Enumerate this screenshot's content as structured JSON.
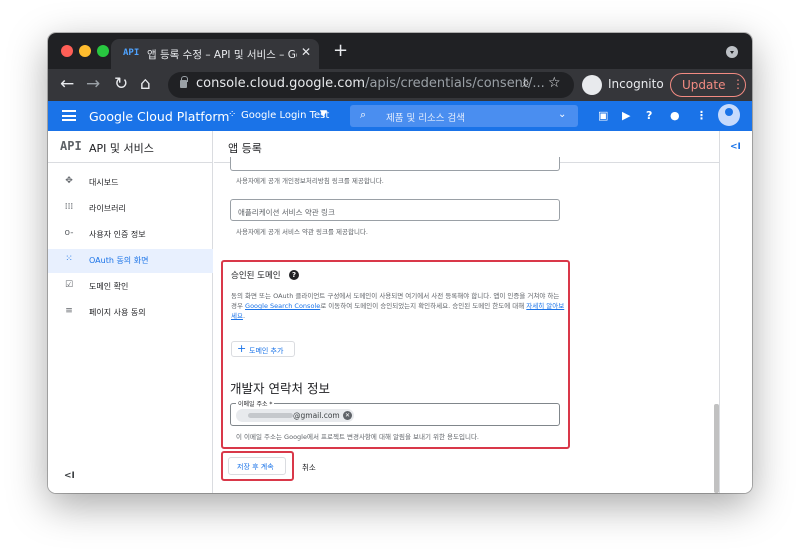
{
  "browser": {
    "tab": {
      "favicon_text": "API",
      "title": "앱 등록 수정 – API 및 서비스 – Goo",
      "close": "✕"
    },
    "new_tab": "+",
    "url_host": "console.cloud.google.com",
    "url_path": "/apis/credentials/consent/...",
    "incognito_label": "Incognito",
    "update_label": "Update",
    "update_menu": "⋮"
  },
  "gcp": {
    "brand": "Google Cloud Platform",
    "project": "Google Login Test",
    "search_placeholder": "제품 및 리소스 검색"
  },
  "sidebar": {
    "api_mark": "API",
    "title": "API 및 서비스",
    "items": [
      {
        "label": "대시보드",
        "icon": "dashboard-icon",
        "glyph": "✥"
      },
      {
        "label": "라이브러리",
        "icon": "library-icon",
        "glyph": "⁞⁞⁞"
      },
      {
        "label": "사용자 인증 정보",
        "icon": "key-icon",
        "glyph": "o-"
      },
      {
        "label": "OAuth 동의 화면",
        "icon": "consent-icon",
        "glyph": "⁙"
      },
      {
        "label": "도메인 확인",
        "icon": "domain-verify-icon",
        "glyph": "☑"
      },
      {
        "label": "페이지 사용 동의",
        "icon": "page-settings-icon",
        "glyph": "≡"
      }
    ],
    "active_index": 3,
    "collapse": "<I"
  },
  "main": {
    "title": "앱 등록",
    "privacy_helper": "사용자에게 공개 개인정보처리방침 링크를 제공합니다.",
    "tos_field_label": "애플리케이션 서비스 약관 링크",
    "tos_helper": "사용자에게 공개 서비스 약관 링크를 제공합니다.",
    "authorized_domains": {
      "title": "승인된 도메인",
      "help": "?",
      "desc_before": "동의 화면 또는 OAuth 클라이언트 구성에서 도메인이 사용되면 여기에서 사전 등록해야 합니다. 앱이 인증을 거쳐야 하는 경우 ",
      "desc_link1": "Google Search Console",
      "desc_middle": "로 이동하여 도메인이 승인되었는지 확인하세요. 승인된 도메인 한도에 대해 ",
      "desc_link2": "자세히 알아보세요",
      "desc_end": ".",
      "add_plus": "+",
      "add_label": "도메인 추가"
    },
    "developer_contact": {
      "title": "개발자 연락처 정보",
      "email_label": "이메일 주소 *",
      "email_value": "@gmail.com",
      "chip_remove": "✕",
      "helper": "이 이메일 주소는 Google에서 프로젝트 변경사항에 대해 알림을 보내기 위한 용도입니다."
    },
    "save_label": "저장 후 계속",
    "cancel_label": "취소"
  },
  "right_rail": {
    "collapse": "<I"
  },
  "colors": {
    "gcp_blue": "#1a73e8",
    "highlight_red": "#d93849",
    "chrome_dark": "#202124",
    "chrome_toolbar": "#35363a"
  }
}
